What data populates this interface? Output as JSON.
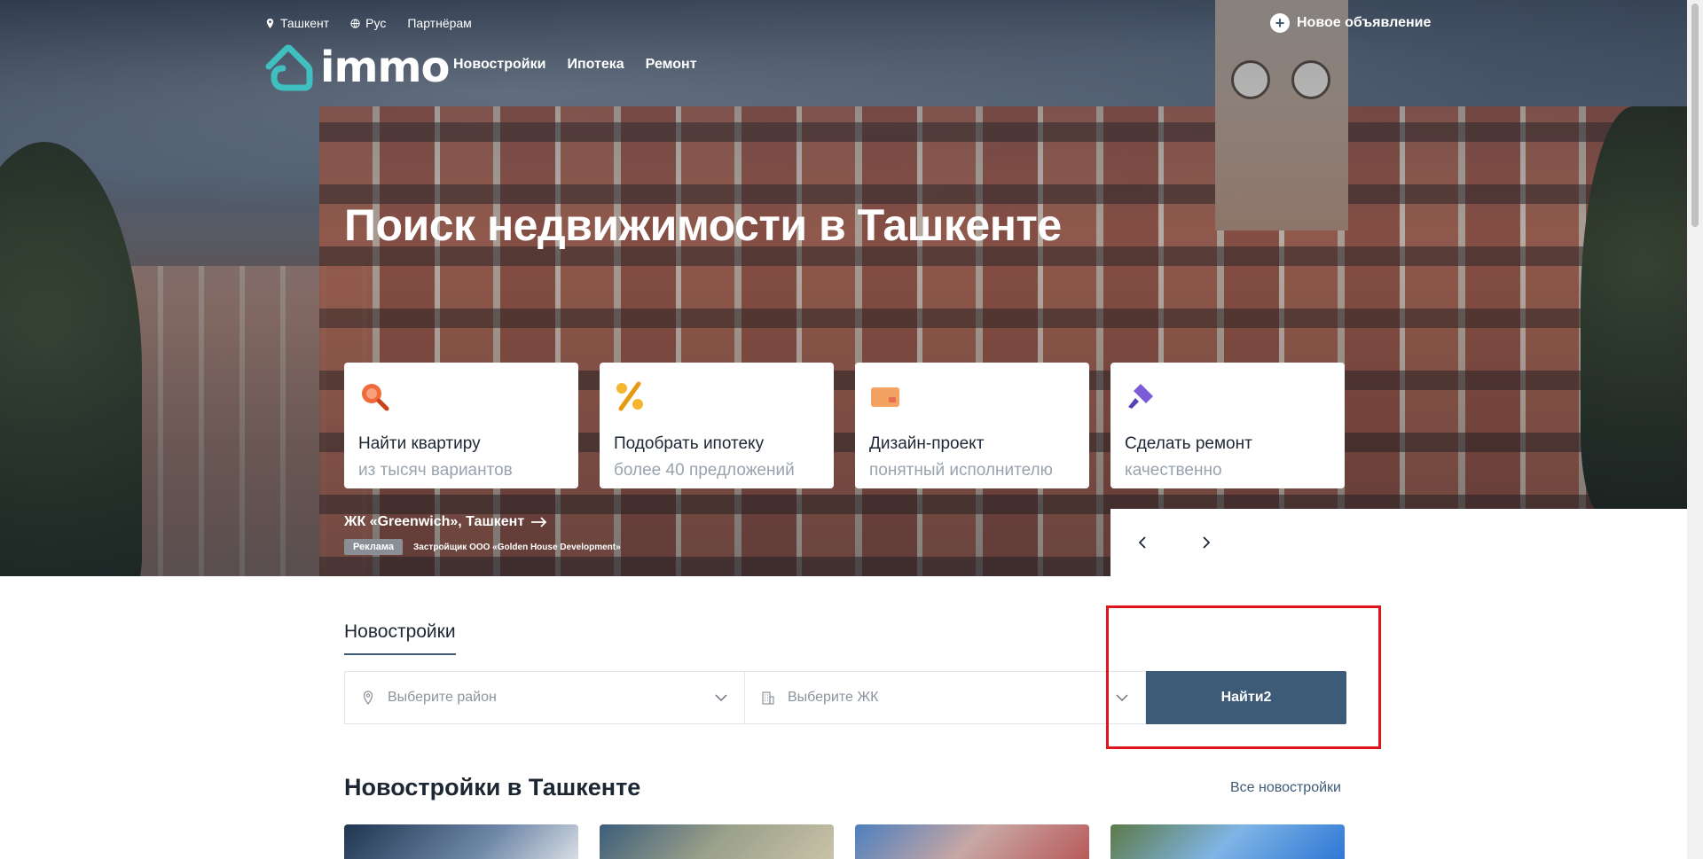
{
  "topbar": {
    "city": "Ташкент",
    "language": "Рус",
    "partners": "Партнёрам",
    "new_ad": "Новое объявление"
  },
  "logo": {
    "text": "immo"
  },
  "nav": [
    "Новостройки",
    "Ипотека",
    "Ремонт"
  ],
  "hero": {
    "title": "Поиск недвижимости в Ташкенте"
  },
  "cards": [
    {
      "title": "Найти квартиру",
      "subtitle": "из тысяч вариантов",
      "icon": "search-icon"
    },
    {
      "title": "Подобрать ипотеку",
      "subtitle": "более 40 предложений",
      "icon": "percent-icon"
    },
    {
      "title": "Дизайн-проект",
      "subtitle": "понятный исполнителю",
      "icon": "card-icon"
    },
    {
      "title": "Сделать ремонт",
      "subtitle": "качественно",
      "icon": "paint-brush-icon"
    }
  ],
  "promo": {
    "name": "ЖК «Greenwich», Ташкент",
    "badge": "Реклама",
    "developer": "Застройщик ООО «Golden House Development»"
  },
  "search": {
    "tab": "Новостройки",
    "district_placeholder": "Выберите район",
    "complex_placeholder": "Выберите ЖК",
    "find_label": "Найти2"
  },
  "section": {
    "title": "Новостройки в Ташкенте",
    "all_link": "Все новостройки"
  },
  "colors": {
    "accent": "#3d5a76",
    "logo": "#3fbfbf",
    "highlight": "#e0151c",
    "search_icon": "#f06b3a",
    "percent_icon": "#f5b731",
    "card_icon": "#f4a261",
    "brush_icon": "#7b5cd6"
  }
}
